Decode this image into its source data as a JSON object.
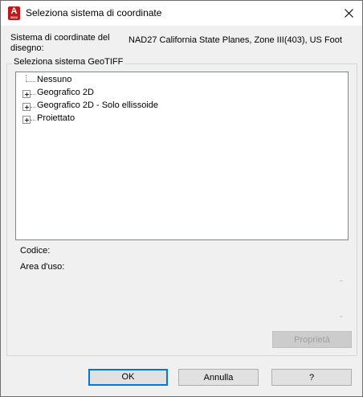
{
  "window": {
    "title": "Seleziona sistema di coordinate",
    "app_icon_letter": "A",
    "app_icon_sub": "2022"
  },
  "drawing_cs": {
    "label": "Sistema di coordinate del disegno:",
    "value": "NAD27 California State Planes, Zone III(403), US Foot"
  },
  "geotiff": {
    "group_title": "Seleziona sistema GeoTIFF",
    "tree": [
      {
        "label": "Nessuno",
        "expandable": false
      },
      {
        "label": "Geografico 2D",
        "expandable": true
      },
      {
        "label": "Geografico 2D - Solo ellissoide",
        "expandable": true
      },
      {
        "label": "Proiettato",
        "expandable": true
      }
    ],
    "code_label": "Codice:",
    "area_label": "Area d'uso:",
    "properties_button": "Proprietà"
  },
  "buttons": {
    "ok": "OK",
    "cancel": "Annulla",
    "help": "?"
  },
  "colors": {
    "accent": "#0078d7",
    "app_icon": "#c4161c"
  }
}
